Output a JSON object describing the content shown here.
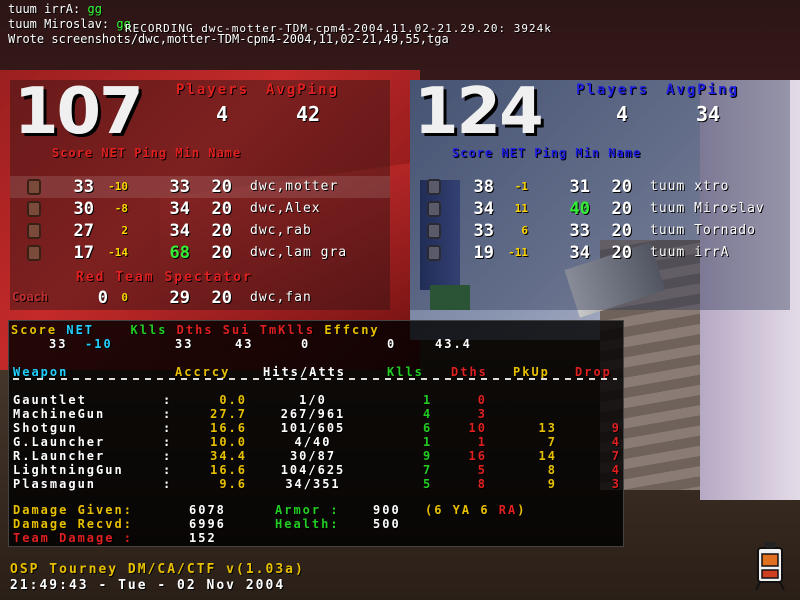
{
  "console": {
    "line1_name": "tuum irrA:",
    "line1_msg": "gg",
    "line2_name": "tuum Miroslav:",
    "line2_msg": "gg",
    "recording": "RECORDING dwc-motter-TDM-cpm4-2004.11.02-21.29.20: 3924k",
    "line3": "Wrote screenshots/dwc,motter-TDM-cpm4-2004,11,02-21,49,55,tga"
  },
  "red_team": {
    "score": "107",
    "players_label": "Players",
    "avgping_label": "AvgPing",
    "players": "4",
    "avgping": "42",
    "columns": "Score NET Ping Min  Name",
    "rows": [
      {
        "score": "33",
        "net": "-10",
        "ping": "33",
        "min": "20",
        "name": "dwc,motter"
      },
      {
        "score": "30",
        "net": "-8",
        "ping": "34",
        "min": "20",
        "name": "dwc,Alex"
      },
      {
        "score": "27",
        "net": "2",
        "ping": "34",
        "min": "20",
        "name": "dwc,rab"
      },
      {
        "score": "17",
        "net": "-14",
        "ping": "68",
        "min": "20",
        "name": "dwc,lam gra"
      }
    ],
    "spectator_header": "Red Team Spectator",
    "coach_label": "Coach",
    "spectator": {
      "score": "0",
      "net": "0",
      "ping": "29",
      "min": "20",
      "name": "dwc,fan"
    }
  },
  "blue_team": {
    "score": "124",
    "players_label": "Players",
    "avgping_label": "AvgPing",
    "players": "4",
    "avgping": "34",
    "columns": "Score NET Ping Min  Name",
    "rows": [
      {
        "score": "38",
        "net": "-1",
        "ping": "31",
        "min": "20",
        "name": "tuum xtro"
      },
      {
        "score": "34",
        "net": "11",
        "ping": "40",
        "min": "20",
        "name": "tuum Miroslav"
      },
      {
        "score": "33",
        "net": "6",
        "ping": "33",
        "min": "20",
        "name": "tuum Tornado"
      },
      {
        "score": "19",
        "net": "-11",
        "ping": "34",
        "min": "20",
        "name": "tuum irrA"
      }
    ]
  },
  "stats": {
    "summary_labels": {
      "score": "Score",
      "net": "NET",
      "kills": "Klls",
      "deaths": "Dths",
      "sui": "Sui",
      "tmkills": "TmKlls",
      "eff": "Effcny"
    },
    "summary_values": {
      "score": "33",
      "net": "-10",
      "kills": "33",
      "deaths": "43",
      "sui": "0",
      "tmkills": "0",
      "eff": "43.4"
    },
    "weapon_headers": {
      "weapon": "Weapon",
      "accrcy": "Accrcy",
      "hits": "Hits/Atts",
      "kills": "Klls",
      "deaths": "Dths",
      "pkup": "PkUp",
      "drop": "Drop"
    },
    "weapons": [
      {
        "name": "Gauntlet",
        "acc": "0.0",
        "hits": "1/0",
        "kills": "1",
        "deaths": "0",
        "pkup": "",
        "drop": ""
      },
      {
        "name": "MachineGun",
        "acc": "27.7",
        "hits": "267/961",
        "kills": "4",
        "deaths": "3",
        "pkup": "",
        "drop": ""
      },
      {
        "name": "Shotgun",
        "acc": "16.6",
        "hits": "101/605",
        "kills": "6",
        "deaths": "10",
        "pkup": "13",
        "drop": "9"
      },
      {
        "name": "G.Launcher",
        "acc": "10.0",
        "hits": "4/40",
        "kills": "1",
        "deaths": "1",
        "pkup": "7",
        "drop": "4"
      },
      {
        "name": "R.Launcher",
        "acc": "34.4",
        "hits": "30/87",
        "kills": "9",
        "deaths": "16",
        "pkup": "14",
        "drop": "7"
      },
      {
        "name": "LightningGun",
        "acc": "16.6",
        "hits": "104/625",
        "kills": "7",
        "deaths": "5",
        "pkup": "8",
        "drop": "4"
      },
      {
        "name": "Plasmagun",
        "acc": "9.6",
        "hits": "34/351",
        "kills": "5",
        "deaths": "8",
        "pkup": "9",
        "drop": "3"
      }
    ],
    "damage_given_label": "Damage Given:",
    "damage_given": "6078",
    "damage_recvd_label": "Damage Recvd:",
    "damage_recvd": "6996",
    "team_damage_label": "Team Damage :",
    "team_damage": "152",
    "armor_label": "Armor :",
    "armor": "900",
    "armor_detail_open": "(6 YA 6 ",
    "armor_detail_ra": "RA",
    "armor_detail_close": ")",
    "health_label": "Health:",
    "health": "500"
  },
  "footer": {
    "title": "OSP Tourney DM/CA/CTF v(1.03a)",
    "datetime": "21:49:43 - Tue - 02 Nov 2004"
  }
}
